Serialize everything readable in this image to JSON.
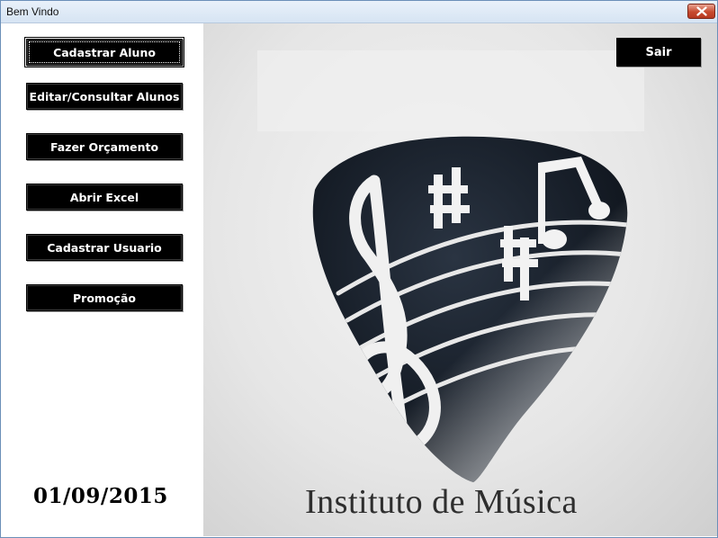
{
  "window": {
    "title": "Bem Vindo"
  },
  "menu": {
    "cadastrar_aluno": "Cadastrar Aluno",
    "editar_consultar": "Editar/Consultar Alunos",
    "fazer_orcamento": "Fazer Orçamento",
    "abrir_excel": "Abrir Excel",
    "cadastrar_usuario": "Cadastrar Usuario",
    "promocao": "Promoção"
  },
  "date": "01/09/2015",
  "header_actions": {
    "sair": "Sair"
  },
  "logo": {
    "text": "Instituto de Música"
  },
  "colors": {
    "button_bg": "#000000",
    "button_text": "#ffffff",
    "pick_dark": "#141c26"
  }
}
